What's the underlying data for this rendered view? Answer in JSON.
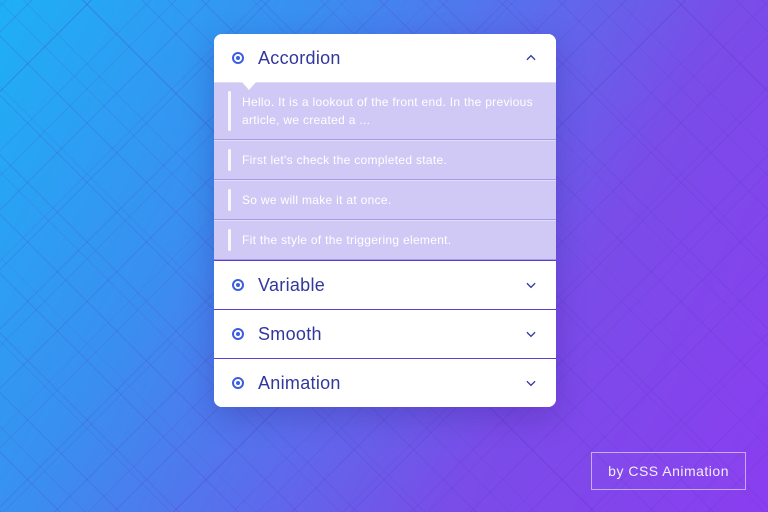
{
  "colors": {
    "accent": "#3b5fe0",
    "title": "#32379b",
    "divider": "#5a3fd4",
    "bg_gradient_from": "#1eb0f6",
    "bg_gradient_to": "#8a3ef0"
  },
  "accordion": {
    "sections": [
      {
        "label": "Accordion",
        "expanded": true,
        "items": [
          "Hello. It is a lookout of the front end. In the previous article, we created a ...",
          "First let's check the completed state.",
          "So we will make it at once.",
          "Fit the style of the triggering element."
        ]
      },
      {
        "label": "Variable",
        "expanded": false
      },
      {
        "label": "Smooth",
        "expanded": false
      },
      {
        "label": "Animation",
        "expanded": false
      }
    ]
  },
  "credit": {
    "text": "by CSS Animation"
  }
}
